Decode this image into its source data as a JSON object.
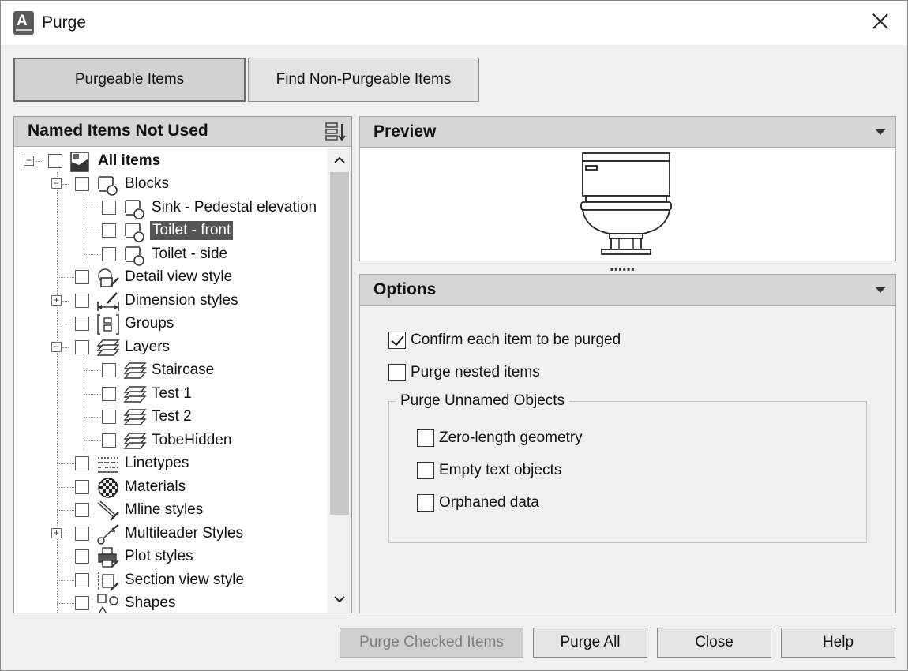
{
  "window": {
    "title": "Purge"
  },
  "tabs": [
    {
      "label": "Purgeable Items",
      "active": true
    },
    {
      "label": "Find Non-Purgeable Items",
      "active": false
    }
  ],
  "left_panel": {
    "header": "Named Items Not Used",
    "tree": [
      {
        "label": "All items",
        "bold": true
      },
      {
        "label": "Blocks"
      },
      {
        "label": "Sink - Pedestal elevation"
      },
      {
        "label": "Toilet - front",
        "selected": true
      },
      {
        "label": "Toilet - side"
      },
      {
        "label": "Detail view style"
      },
      {
        "label": "Dimension styles"
      },
      {
        "label": "Groups"
      },
      {
        "label": "Layers"
      },
      {
        "label": "Staircase"
      },
      {
        "label": "Test 1"
      },
      {
        "label": "Test 2"
      },
      {
        "label": "TobeHidden"
      },
      {
        "label": "Linetypes"
      },
      {
        "label": "Materials"
      },
      {
        "label": "Mline styles"
      },
      {
        "label": "Multileader Styles"
      },
      {
        "label": "Plot styles"
      },
      {
        "label": "Section view style"
      },
      {
        "label": "Shapes"
      }
    ]
  },
  "preview": {
    "header": "Preview"
  },
  "options": {
    "header": "Options",
    "confirm_label": "Confirm each item to be purged",
    "confirm_checked": true,
    "nested_label": "Purge nested items",
    "nested_checked": false,
    "group_title": "Purge Unnamed Objects",
    "unnamed": [
      {
        "label": "Zero-length geometry",
        "checked": false
      },
      {
        "label": "Empty text objects",
        "checked": false
      },
      {
        "label": "Orphaned data",
        "checked": false
      }
    ]
  },
  "buttons": {
    "purge_checked": "Purge Checked Items",
    "purge_all": "Purge All",
    "close": "Close",
    "help": "Help"
  }
}
